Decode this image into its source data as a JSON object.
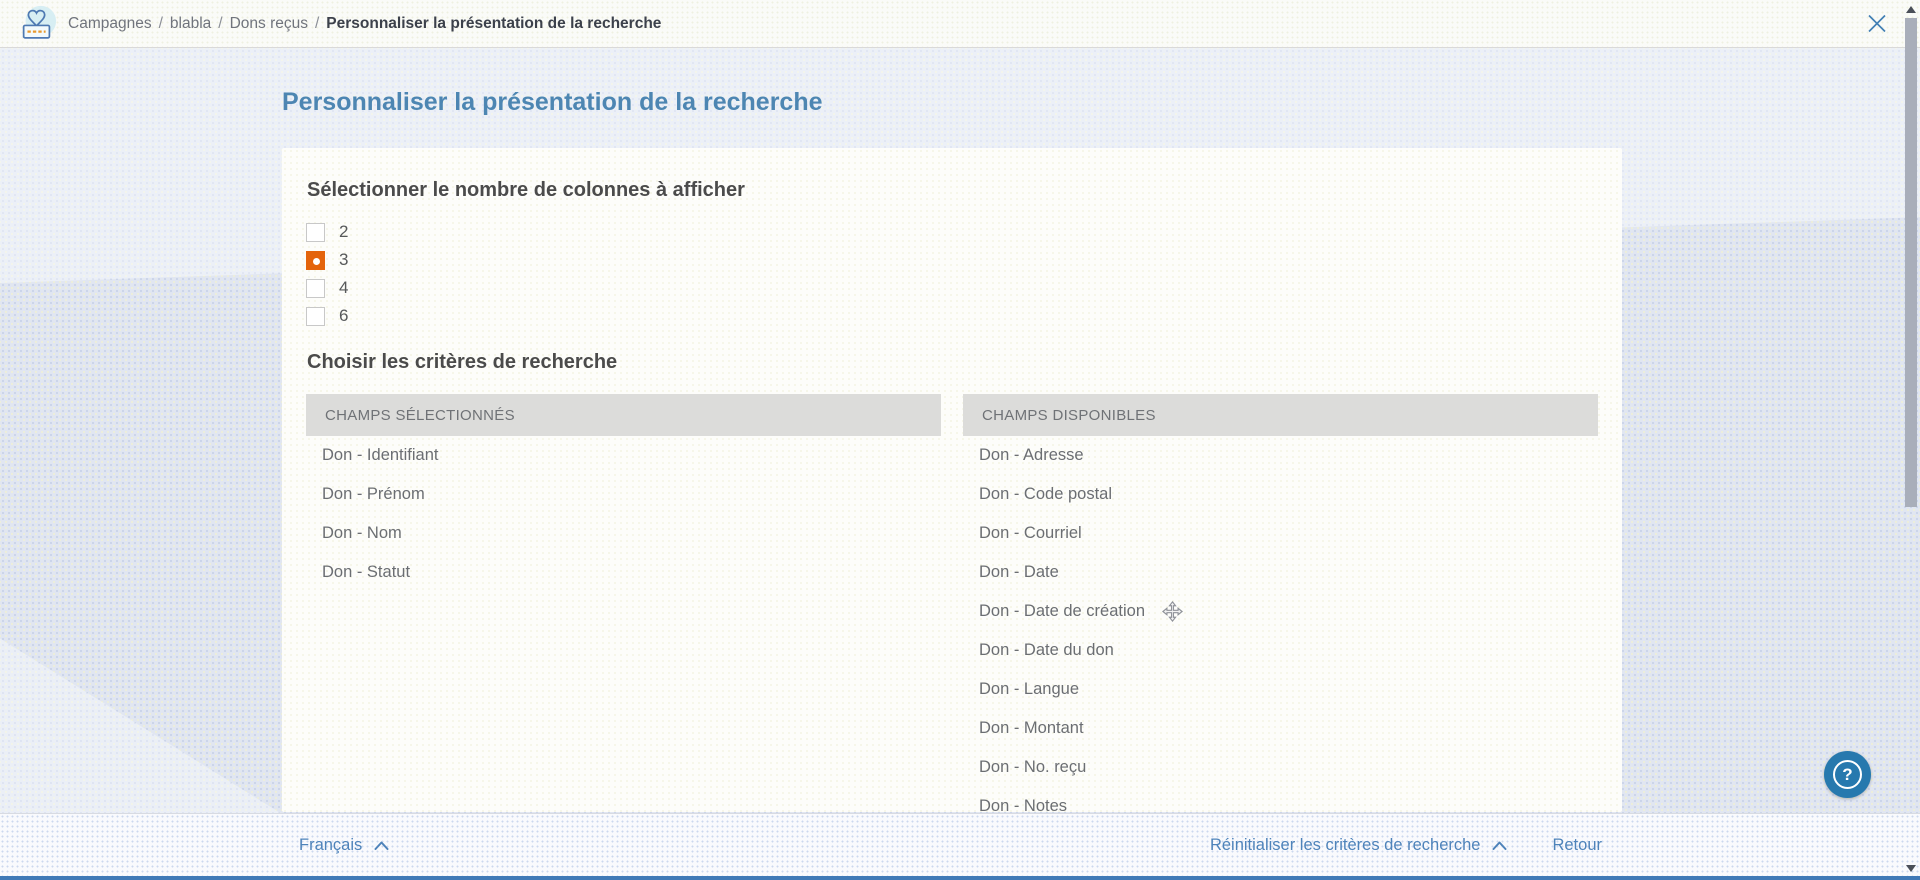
{
  "topbar": {
    "breadcrumb": [
      {
        "label": "Campagnes"
      },
      {
        "label": "blabla"
      },
      {
        "label": "Dons reçus"
      },
      {
        "label": "Personnaliser la présentation de la recherche"
      }
    ],
    "separator": "/"
  },
  "page": {
    "title": "Personnaliser la présentation de la recherche"
  },
  "card": {
    "columns_heading": "Sélectionner le nombre de colonnes à afficher",
    "column_options": [
      {
        "value": "2",
        "selected": false
      },
      {
        "value": "3",
        "selected": true
      },
      {
        "value": "4",
        "selected": false
      },
      {
        "value": "6",
        "selected": false
      }
    ],
    "criteria_heading": "Choisir les critères de recherche",
    "selected_fields": {
      "header": "CHAMPS SÉLECTIONNÉS",
      "items": [
        "Don - Identifiant",
        "Don - Prénom",
        "Don - Nom",
        "Don - Statut"
      ]
    },
    "available_fields": {
      "header": "CHAMPS DISPONIBLES",
      "items": [
        "Don - Adresse",
        "Don - Code postal",
        "Don - Courriel",
        "Don - Date",
        "Don - Date de création",
        "Don - Date du don",
        "Don - Langue",
        "Don - Montant",
        "Don - No. reçu",
        "Don - Notes"
      ]
    }
  },
  "footer": {
    "language_label": "Français",
    "reset_label": "Réinitialiser les critères de recherche",
    "back_label": "Retour"
  },
  "icons": {
    "question_mark": "?"
  },
  "colors": {
    "accent_orange": "#e4640c",
    "title_blue": "#4d86b2",
    "link_blue": "#4e83ba",
    "help_blue": "#2779ae",
    "bottom_bar_blue": "#3f79b7"
  }
}
